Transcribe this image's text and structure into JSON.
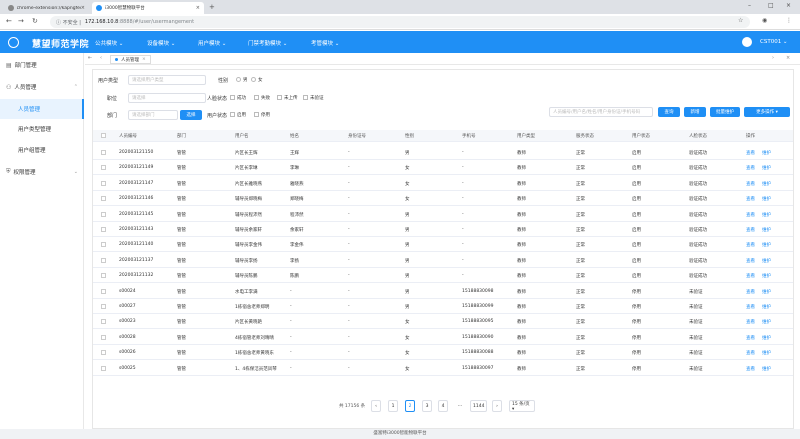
{
  "browser": {
    "tabs": [
      {
        "label": "chrome-extension://kapngfed",
        "color": "#888888"
      },
      {
        "label": "i3000智慧物联平台",
        "color": "#1f8ff5"
      }
    ],
    "new_tab": "+",
    "security_warning": "不安全",
    "url_host": "172.168.10.8",
    "url_path": ":8888/#/user/usermangement"
  },
  "app": {
    "title": "慧望师范学院",
    "menu": [
      "公共模块 ⌄",
      "设备模块 ⌄",
      "用户模块 ⌄",
      "门禁考勤模块 ⌄",
      "考管模块 ⌄"
    ],
    "user": "CST001 ⌄"
  },
  "sidebar": {
    "items": [
      {
        "label": "部门管理",
        "icon": "building-icon"
      },
      {
        "label": "人员管理",
        "icon": "person-icon",
        "expanded": true
      },
      {
        "label": "权限管理",
        "icon": "shield-icon"
      }
    ],
    "subitems": [
      "人员管理",
      "用户类型管理",
      "用户组管理"
    ]
  },
  "page_tab": {
    "label": "人员管理"
  },
  "filters": {
    "user_type_label": "用户类型",
    "user_type_placeholder": "请选择用户类型",
    "gender_label": "性别",
    "gender_options": [
      "男",
      "女"
    ],
    "position_label": "职位",
    "position_placeholder": "请选择",
    "face_status_label": "人脸状态",
    "face_status_options": [
      "成功",
      "失败",
      "未上传",
      "未验证"
    ],
    "dept_label": "部门",
    "dept_placeholder": "请选择部门",
    "select_button": "选择",
    "user_status_label": "用户状态",
    "user_status_options": [
      "启用",
      "停用"
    ],
    "search_placeholder": "人员编号/用户名/姓名/用户身份证/手机号码",
    "query_button": "查询",
    "add_button": "新增",
    "batch_button": "批量维护",
    "more_button": "更多操作 ▾"
  },
  "table": {
    "headers": [
      "人员编号",
      "部门",
      "用户名",
      "姓名",
      "身份证号",
      "性别",
      "手机号",
      "用户类型",
      "服务状态",
      "用户状态",
      "人脸状态",
      "操作"
    ],
    "rows": [
      [
        "202003121150",
        "管管",
        "片区长王辉",
        "王辉",
        "-",
        "男",
        "-",
        "教师",
        "正常",
        "启用",
        "验证成功"
      ],
      [
        "202003121149",
        "管管",
        "片区长李琳",
        "李琳",
        "-",
        "女",
        "-",
        "教师",
        "正常",
        "启用",
        "验证成功"
      ],
      [
        "202003121147",
        "管管",
        "片区长雅晓燕",
        "雅晓燕",
        "-",
        "女",
        "-",
        "教师",
        "正常",
        "启用",
        "验证成功"
      ],
      [
        "202003121146",
        "管管",
        "辅导员郑晓梅",
        "郑晓梅",
        "-",
        "女",
        "-",
        "教师",
        "正常",
        "启用",
        "验证成功"
      ],
      [
        "202003121145",
        "管管",
        "辅导员程沛然",
        "程沛然",
        "-",
        "男",
        "-",
        "教师",
        "正常",
        "启用",
        "验证成功"
      ],
      [
        "202003121143",
        "管管",
        "辅导员余家轩",
        "余家轩",
        "-",
        "男",
        "-",
        "教师",
        "正常",
        "启用",
        "验证成功"
      ],
      [
        "202003121140",
        "管管",
        "辅导员李金伟",
        "李金伟",
        "-",
        "男",
        "-",
        "教师",
        "正常",
        "启用",
        "验证成功"
      ],
      [
        "202003121137",
        "管管",
        "辅导员李扬",
        "李扬",
        "-",
        "男",
        "-",
        "教师",
        "正常",
        "启用",
        "验证成功"
      ],
      [
        "202003121132",
        "管管",
        "辅导员陈鹏",
        "陈鹏",
        "-",
        "男",
        "-",
        "教师",
        "正常",
        "启用",
        "验证成功"
      ],
      [
        "s00024",
        "管管",
        "水电工李满",
        "-",
        "-",
        "男",
        "15188830098",
        "教师",
        "正常",
        "停用",
        "未验证"
      ],
      [
        "s00027",
        "管管",
        "1栋宿舍老师郑明",
        "-",
        "-",
        "男",
        "15188830099",
        "教师",
        "正常",
        "停用",
        "未验证"
      ],
      [
        "s00023",
        "管管",
        "片区长黄晓艳",
        "-",
        "-",
        "女",
        "15188830095",
        "教师",
        "正常",
        "停用",
        "未验证"
      ],
      [
        "s00028",
        "管管",
        "4栋宿管老师刘晴晴",
        "-",
        "-",
        "女",
        "15188830090",
        "教师",
        "正常",
        "停用",
        "未验证"
      ],
      [
        "s00026",
        "管管",
        "1栋宿舍老师黄晓东",
        "-",
        "-",
        "女",
        "15188830088",
        "教师",
        "正常",
        "停用",
        "未验证"
      ],
      [
        "s00025",
        "管管",
        "1、4栋保洁员范凤琴",
        "-",
        "-",
        "女",
        "15188830097",
        "教师",
        "正常",
        "停用",
        "未验证"
      ]
    ],
    "action_view": "查看",
    "action_edit": "维护"
  },
  "pagination": {
    "total": "共 17156 条",
    "prev": "‹",
    "pages": [
      "1",
      "2",
      "3",
      "4",
      "···",
      "1144"
    ],
    "active_page": "2",
    "next": "›",
    "page_size": "15 条/页 ▾"
  },
  "footer": "盛富特i3000智能物联平台",
  "colors": {
    "primary": "#1f8ff5"
  }
}
